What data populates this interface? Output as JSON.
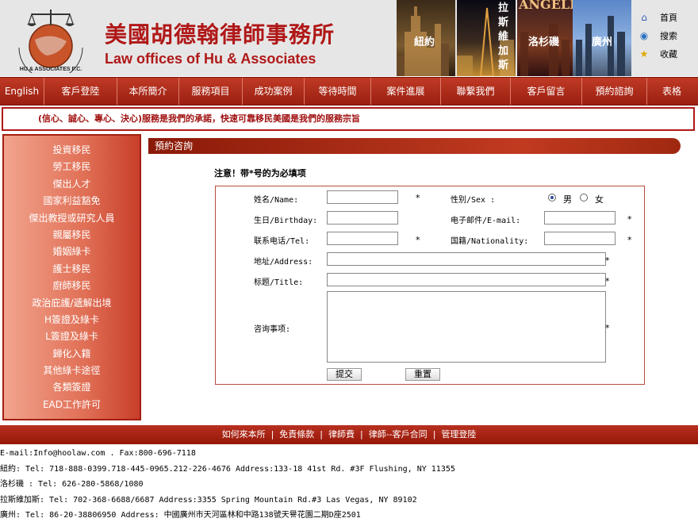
{
  "header": {
    "title_cn": "美國胡德翰律師事務所",
    "title_en": "Law offices of Hu & Associates",
    "logo_text": "HU & ASSOCIATES P.C.",
    "cities": [
      "紐約",
      "拉斯維加斯",
      "洛杉磯",
      "廣州"
    ],
    "city_sign": "ANGELES",
    "quick_links": [
      {
        "label": "首頁",
        "icon": "house-icon"
      },
      {
        "label": "搜索",
        "icon": "globe-search-icon"
      },
      {
        "label": "收藏",
        "icon": "star-icon"
      }
    ]
  },
  "nav": [
    "English",
    "客戶登陸",
    "本所簡介",
    "服務項目",
    "成功案例",
    "等待時間",
    "案件進展",
    "聯繫我們",
    "客戶留言",
    "預約諮詢",
    "表格"
  ],
  "slogan": "(信心、誠心、專心、決心)服務是我們的承諾，快速可靠移民美國是我們的服務宗旨",
  "sidebar": [
    "投資移民",
    "勞工移民",
    "傑出人才",
    "國家利益豁免",
    "傑出教授或研究人員",
    "親屬移民",
    "婚姻綠卡",
    "護士移民",
    "廚師移民",
    "政治庇護/遞解出境",
    "H簽證及綠卡",
    "L簽證及綠卡",
    "歸化入籍",
    "其他綠卡途徑",
    "各類簽證",
    "EAD工作許可"
  ],
  "main": {
    "section_title": "預約咨詢",
    "notice": "注意！带*号的为必填项",
    "form": {
      "name_label": "姓名/Name:",
      "sex_label": "性别/Sex :",
      "male": "男",
      "female": "女",
      "sex_selected": "男",
      "birthday_label": "生日/Birthday:",
      "email_label": "电子邮件/E-mail:",
      "tel_label": "联系电话/Tel:",
      "nationality_label": "国籍/Nationality:",
      "address_label": "地址/Address:",
      "title_label": "标题/Title:",
      "consult_label": "咨询事项:",
      "required_mark": "*",
      "submit": "提交",
      "reset": "重置"
    }
  },
  "footer": {
    "links": [
      "如何來本所",
      "免責條款",
      "律師費",
      "律師--客戶合同",
      "管理登陸"
    ],
    "separator": "|",
    "contact": [
      "E-mail:Info@hoolaw.com .  Fax:800-696-7118",
      "紐約: Tel: 718-888-0399.718-445-0965.212-226-4676 Address:133-18 41st Rd. #3F Flushing, NY 11355",
      "洛杉磯 : Tel: 626-280-5868/1080",
      "拉斯維加斯: Tel: 702-368-6688/6687 Address:3355 Spring Mountain Rd.#3 Las Vegas, NY 89102",
      "廣州: Tel: 86-20-38806950 Address: 中國廣州市天河區林和中路138號天譽花園二期D座2501"
    ]
  },
  "colors": {
    "brand_red": "#b01818",
    "nav_red": "#9a1f10",
    "sidebar_salmon": "#e06f55"
  }
}
